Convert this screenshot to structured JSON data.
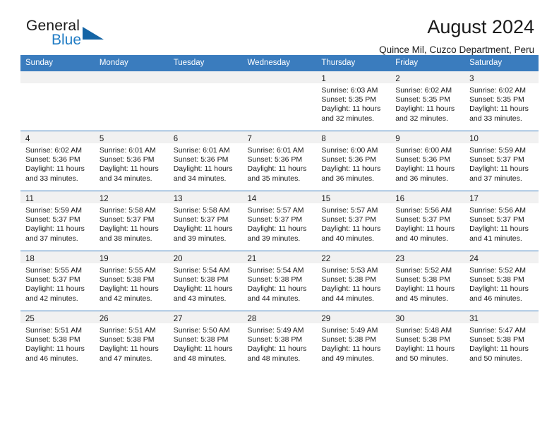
{
  "brand": {
    "name_part1": "General",
    "name_part2": "Blue",
    "triangle_icon": "triangle-icon",
    "accent_color": "#1f7bc4",
    "header_color": "#3a7cbe"
  },
  "header": {
    "title": "August 2024",
    "subtitle": "Quince Mil, Cuzco Department, Peru"
  },
  "weekday_headers": [
    "Sunday",
    "Monday",
    "Tuesday",
    "Wednesday",
    "Thursday",
    "Friday",
    "Saturday"
  ],
  "weeks": [
    [
      {
        "day": "",
        "empty": true
      },
      {
        "day": "",
        "empty": true
      },
      {
        "day": "",
        "empty": true
      },
      {
        "day": "",
        "empty": true
      },
      {
        "day": "1",
        "sunrise": "Sunrise: 6:03 AM",
        "sunset": "Sunset: 5:35 PM",
        "daylight1": "Daylight: 11 hours",
        "daylight2": "and 32 minutes."
      },
      {
        "day": "2",
        "sunrise": "Sunrise: 6:02 AM",
        "sunset": "Sunset: 5:35 PM",
        "daylight1": "Daylight: 11 hours",
        "daylight2": "and 32 minutes."
      },
      {
        "day": "3",
        "sunrise": "Sunrise: 6:02 AM",
        "sunset": "Sunset: 5:35 PM",
        "daylight1": "Daylight: 11 hours",
        "daylight2": "and 33 minutes."
      }
    ],
    [
      {
        "day": "4",
        "sunrise": "Sunrise: 6:02 AM",
        "sunset": "Sunset: 5:36 PM",
        "daylight1": "Daylight: 11 hours",
        "daylight2": "and 33 minutes."
      },
      {
        "day": "5",
        "sunrise": "Sunrise: 6:01 AM",
        "sunset": "Sunset: 5:36 PM",
        "daylight1": "Daylight: 11 hours",
        "daylight2": "and 34 minutes."
      },
      {
        "day": "6",
        "sunrise": "Sunrise: 6:01 AM",
        "sunset": "Sunset: 5:36 PM",
        "daylight1": "Daylight: 11 hours",
        "daylight2": "and 34 minutes."
      },
      {
        "day": "7",
        "sunrise": "Sunrise: 6:01 AM",
        "sunset": "Sunset: 5:36 PM",
        "daylight1": "Daylight: 11 hours",
        "daylight2": "and 35 minutes."
      },
      {
        "day": "8",
        "sunrise": "Sunrise: 6:00 AM",
        "sunset": "Sunset: 5:36 PM",
        "daylight1": "Daylight: 11 hours",
        "daylight2": "and 36 minutes."
      },
      {
        "day": "9",
        "sunrise": "Sunrise: 6:00 AM",
        "sunset": "Sunset: 5:36 PM",
        "daylight1": "Daylight: 11 hours",
        "daylight2": "and 36 minutes."
      },
      {
        "day": "10",
        "sunrise": "Sunrise: 5:59 AM",
        "sunset": "Sunset: 5:37 PM",
        "daylight1": "Daylight: 11 hours",
        "daylight2": "and 37 minutes."
      }
    ],
    [
      {
        "day": "11",
        "sunrise": "Sunrise: 5:59 AM",
        "sunset": "Sunset: 5:37 PM",
        "daylight1": "Daylight: 11 hours",
        "daylight2": "and 37 minutes."
      },
      {
        "day": "12",
        "sunrise": "Sunrise: 5:58 AM",
        "sunset": "Sunset: 5:37 PM",
        "daylight1": "Daylight: 11 hours",
        "daylight2": "and 38 minutes."
      },
      {
        "day": "13",
        "sunrise": "Sunrise: 5:58 AM",
        "sunset": "Sunset: 5:37 PM",
        "daylight1": "Daylight: 11 hours",
        "daylight2": "and 39 minutes."
      },
      {
        "day": "14",
        "sunrise": "Sunrise: 5:57 AM",
        "sunset": "Sunset: 5:37 PM",
        "daylight1": "Daylight: 11 hours",
        "daylight2": "and 39 minutes."
      },
      {
        "day": "15",
        "sunrise": "Sunrise: 5:57 AM",
        "sunset": "Sunset: 5:37 PM",
        "daylight1": "Daylight: 11 hours",
        "daylight2": "and 40 minutes."
      },
      {
        "day": "16",
        "sunrise": "Sunrise: 5:56 AM",
        "sunset": "Sunset: 5:37 PM",
        "daylight1": "Daylight: 11 hours",
        "daylight2": "and 40 minutes."
      },
      {
        "day": "17",
        "sunrise": "Sunrise: 5:56 AM",
        "sunset": "Sunset: 5:37 PM",
        "daylight1": "Daylight: 11 hours",
        "daylight2": "and 41 minutes."
      }
    ],
    [
      {
        "day": "18",
        "sunrise": "Sunrise: 5:55 AM",
        "sunset": "Sunset: 5:37 PM",
        "daylight1": "Daylight: 11 hours",
        "daylight2": "and 42 minutes."
      },
      {
        "day": "19",
        "sunrise": "Sunrise: 5:55 AM",
        "sunset": "Sunset: 5:38 PM",
        "daylight1": "Daylight: 11 hours",
        "daylight2": "and 42 minutes."
      },
      {
        "day": "20",
        "sunrise": "Sunrise: 5:54 AM",
        "sunset": "Sunset: 5:38 PM",
        "daylight1": "Daylight: 11 hours",
        "daylight2": "and 43 minutes."
      },
      {
        "day": "21",
        "sunrise": "Sunrise: 5:54 AM",
        "sunset": "Sunset: 5:38 PM",
        "daylight1": "Daylight: 11 hours",
        "daylight2": "and 44 minutes."
      },
      {
        "day": "22",
        "sunrise": "Sunrise: 5:53 AM",
        "sunset": "Sunset: 5:38 PM",
        "daylight1": "Daylight: 11 hours",
        "daylight2": "and 44 minutes."
      },
      {
        "day": "23",
        "sunrise": "Sunrise: 5:52 AM",
        "sunset": "Sunset: 5:38 PM",
        "daylight1": "Daylight: 11 hours",
        "daylight2": "and 45 minutes."
      },
      {
        "day": "24",
        "sunrise": "Sunrise: 5:52 AM",
        "sunset": "Sunset: 5:38 PM",
        "daylight1": "Daylight: 11 hours",
        "daylight2": "and 46 minutes."
      }
    ],
    [
      {
        "day": "25",
        "sunrise": "Sunrise: 5:51 AM",
        "sunset": "Sunset: 5:38 PM",
        "daylight1": "Daylight: 11 hours",
        "daylight2": "and 46 minutes."
      },
      {
        "day": "26",
        "sunrise": "Sunrise: 5:51 AM",
        "sunset": "Sunset: 5:38 PM",
        "daylight1": "Daylight: 11 hours",
        "daylight2": "and 47 minutes."
      },
      {
        "day": "27",
        "sunrise": "Sunrise: 5:50 AM",
        "sunset": "Sunset: 5:38 PM",
        "daylight1": "Daylight: 11 hours",
        "daylight2": "and 48 minutes."
      },
      {
        "day": "28",
        "sunrise": "Sunrise: 5:49 AM",
        "sunset": "Sunset: 5:38 PM",
        "daylight1": "Daylight: 11 hours",
        "daylight2": "and 48 minutes."
      },
      {
        "day": "29",
        "sunrise": "Sunrise: 5:49 AM",
        "sunset": "Sunset: 5:38 PM",
        "daylight1": "Daylight: 11 hours",
        "daylight2": "and 49 minutes."
      },
      {
        "day": "30",
        "sunrise": "Sunrise: 5:48 AM",
        "sunset": "Sunset: 5:38 PM",
        "daylight1": "Daylight: 11 hours",
        "daylight2": "and 50 minutes."
      },
      {
        "day": "31",
        "sunrise": "Sunrise: 5:47 AM",
        "sunset": "Sunset: 5:38 PM",
        "daylight1": "Daylight: 11 hours",
        "daylight2": "and 50 minutes."
      }
    ]
  ]
}
